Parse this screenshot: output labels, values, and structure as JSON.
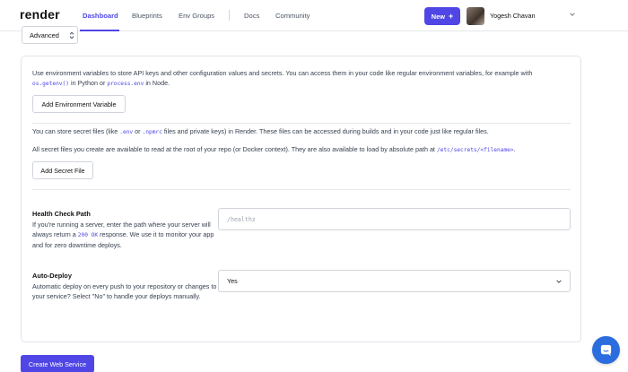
{
  "nav": {
    "logo": "render",
    "links": [
      "Dashboard",
      "Blueprints",
      "Env Groups",
      "Docs",
      "Community"
    ],
    "new_label": "New",
    "user_name": "Yogesh Chavan",
    "accent": "#4f46e5"
  },
  "advanced": {
    "label": "Advanced"
  },
  "env": {
    "desc_1": "Use environment variables to store API keys and other configuration values and secrets. You can access them in your code like regular environment variables, for example with",
    "code_getenv": "os.getenv()",
    "in_python": "in Python or",
    "code_processenv": "process.env",
    "in_node": "in Node.",
    "add_env_label": "Add Environment Variable"
  },
  "secrets": {
    "desc_a": "You can store secret files (like",
    "code_env": ".env",
    "or": "or",
    "code_npmrc": ".npmrc",
    "desc_b": "files and private keys) in Render. These files can be accessed during builds and in your code just like regular files.",
    "desc_2": "All secret files you create are available to read at the root of your repo (or Docker context). They are also available to load by absolute path at",
    "code_path": "/etc/secrets/<filename>",
    "period": ".",
    "add_secret_label": "Add Secret File"
  },
  "health": {
    "title": "Health Check Path",
    "desc_1": "If you're running a server, enter the path where your server will always return a",
    "code_200": "200 OK",
    "desc_2": "response. We use it to monitor your app and for zero downtime deploys.",
    "placeholder": "/healthz"
  },
  "autodeploy": {
    "title": "Auto-Deploy",
    "desc": "Automatic deploy on every push to your repository or changes to your service? Select \"No\" to handle your deploys manually.",
    "value": "Yes"
  },
  "create_label": "Create Web Service"
}
